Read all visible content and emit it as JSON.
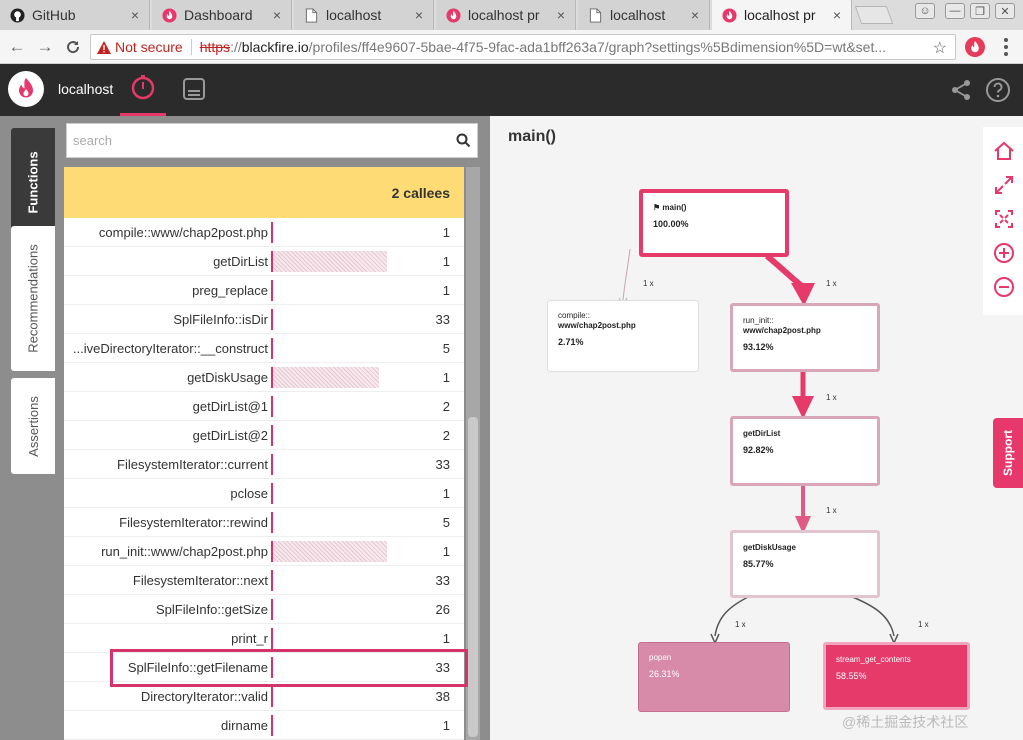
{
  "browser": {
    "tabs": [
      {
        "title": "GitHub",
        "icon": "github-icon",
        "active": false
      },
      {
        "title": "Dashboard",
        "icon": "blackfire-icon",
        "active": false
      },
      {
        "title": "localhost",
        "icon": "page-icon",
        "active": false
      },
      {
        "title": "localhost pr",
        "icon": "blackfire-icon",
        "active": false
      },
      {
        "title": "localhost",
        "icon": "page-icon",
        "active": false
      },
      {
        "title": "localhost pr",
        "icon": "blackfire-icon",
        "active": true
      }
    ],
    "close_glyph": "×",
    "security_label": "Not secure",
    "url_scheme": "https",
    "url_sep": "://",
    "url_domain": "blackfire.io",
    "url_path": "/profiles/ff4e9607-5bae-4f75-9fac-ada1bff263a7/graph?settings%5Bdimension%5D=wt&set...",
    "accent_color": "#e6386b"
  },
  "app": {
    "project": "localhost",
    "header_tabs": [
      {
        "icon": "timer-icon",
        "active": true
      },
      {
        "icon": "timeline-icon",
        "active": false
      }
    ]
  },
  "side_tabs": [
    "Functions",
    "Recommendations",
    "Assertions"
  ],
  "functions": {
    "search_placeholder": "search",
    "callees_header": "2 callees",
    "rows": [
      {
        "name": "compile::www/chap2post.php",
        "count": "1",
        "bar": 0
      },
      {
        "name": "getDirList",
        "count": "1",
        "bar": 0.29
      },
      {
        "name": "preg_replace",
        "count": "1",
        "bar": 0
      },
      {
        "name": "SplFileInfo::isDir",
        "count": "33",
        "bar": 0
      },
      {
        "name": "...iveDirectoryIterator::__construct",
        "count": "5",
        "bar": 0
      },
      {
        "name": "getDiskUsage",
        "count": "1",
        "bar": 0.27
      },
      {
        "name": "getDirList@1",
        "count": "2",
        "bar": 0
      },
      {
        "name": "getDirList@2",
        "count": "2",
        "bar": 0
      },
      {
        "name": "FilesystemIterator::current",
        "count": "33",
        "bar": 0
      },
      {
        "name": "pclose",
        "count": "1",
        "bar": 0
      },
      {
        "name": "FilesystemIterator::rewind",
        "count": "5",
        "bar": 0
      },
      {
        "name": "run_init::www/chap2post.php",
        "count": "1",
        "bar": 0.29
      },
      {
        "name": "FilesystemIterator::next",
        "count": "33",
        "bar": 0
      },
      {
        "name": "SplFileInfo::getSize",
        "count": "26",
        "bar": 0
      },
      {
        "name": "print_r",
        "count": "1",
        "bar": 0
      },
      {
        "name": "SplFileInfo::getFilename",
        "count": "33",
        "bar": 0
      },
      {
        "name": "DirectoryIterator::valid",
        "count": "38",
        "bar": 0
      },
      {
        "name": "dirname",
        "count": "1",
        "bar": 0
      }
    ]
  },
  "graph": {
    "title": "main()",
    "nodes": [
      {
        "id": "main",
        "label": "",
        "name": "main()",
        "pct": "100.00%"
      },
      {
        "id": "compile",
        "label": "compile::",
        "name": "www/chap2post.php",
        "pct": "2.71%"
      },
      {
        "id": "run_init",
        "label": "run_init::",
        "name": "www/chap2post.php",
        "pct": "93.12%"
      },
      {
        "id": "getDirList",
        "label": "",
        "name": "getDirList",
        "pct": "92.82%"
      },
      {
        "id": "getDiskUsage",
        "label": "",
        "name": "getDiskUsage",
        "pct": "85.77%"
      },
      {
        "id": "popen",
        "label": "",
        "name": "popen",
        "pct": "26.31%"
      },
      {
        "id": "stream",
        "label": "",
        "name": "stream_get_contents",
        "pct": "58.55%"
      }
    ],
    "call_labels": [
      "1 x",
      "1 x",
      "1 x",
      "1 x",
      "1 x",
      "1 x"
    ],
    "support_label": "Support"
  },
  "watermark": "@稀土掘金技术社区"
}
